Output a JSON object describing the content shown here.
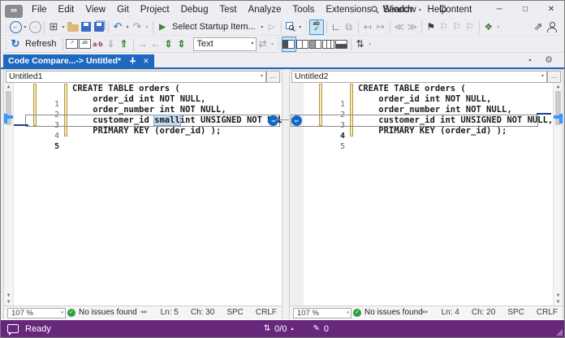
{
  "titlebar": {
    "menus": [
      "File",
      "Edit",
      "View",
      "Git",
      "Project",
      "Debug",
      "Test",
      "Analyze",
      "Tools",
      "Extensions",
      "Window",
      "Help"
    ],
    "search_label": "Search",
    "content_label": "Content"
  },
  "toolbar": {
    "startup_item": "Select Startup Item...",
    "refresh_label": "Refresh",
    "compare_mode_value": "Text",
    "row1_icons": [
      "navigate-back",
      "navigate-forward",
      "new-project",
      "open-file",
      "save",
      "save-all",
      "undo",
      "redo",
      "start-debugging",
      "start-without-debugging",
      "find-in-files",
      "spell-check",
      "ruler",
      "copy-format",
      "navigate-prev",
      "navigate-next",
      "shift-left",
      "shift-right",
      "toggle-bookmark",
      "prev-bookmark",
      "next-bookmark",
      "clear-bookmarks",
      "code-cleanup",
      "send-feedback",
      "account"
    ],
    "row2_icons": [
      "refresh",
      "fit-view",
      "find-text",
      "ignore-case",
      "next-difference",
      "prev-difference",
      "copy-to-right",
      "copy-to-left",
      "expand-all",
      "collapse-all",
      "sync-scrolling",
      "layout-side-by-side",
      "layout-vertical-split",
      "layout-left-emphasis",
      "layout-three-way",
      "layout-horizontal",
      "merge-lines"
    ]
  },
  "tabbar": {
    "active_tab": "Code Compare...-> Untitled*"
  },
  "panes": [
    {
      "file": "Untitled1",
      "zoom": "107 %",
      "issues": "No issues found",
      "ln": "Ln: 5",
      "ch": "Ch: 30",
      "spc": "SPC",
      "eol": "CRLF",
      "lines": [
        {
          "num": "1",
          "text": "CREATE TABLE orders ("
        },
        {
          "num": "2",
          "text": "    order_id int NOT NULL,"
        },
        {
          "num": "3",
          "text": "    order_number int NOT NULL,"
        },
        {
          "num": "4",
          "pre": "    customer_id ",
          "sel": "small",
          "post": "int UNSIGNED NOT NULL,"
        },
        {
          "num": "5",
          "text": "    PRIMARY KEY (order_id) );"
        }
      ]
    },
    {
      "file": "Untitled2",
      "zoom": "107 %",
      "issues": "No issues found",
      "ln": "Ln: 4",
      "ch": "Ch: 20",
      "spc": "SPC",
      "eol": "CRLF",
      "lines": [
        {
          "num": "1",
          "text": "CREATE TABLE orders ("
        },
        {
          "num": "2",
          "text": "    order_id int NOT NULL,"
        },
        {
          "num": "3",
          "text": "    order_number int NOT NULL,"
        },
        {
          "num": "4",
          "text": "    customer_id int UNSIGNED NOT NULL,"
        },
        {
          "num": "5",
          "text": "    PRIMARY KEY (order_id) );"
        }
      ]
    }
  ],
  "statusbar": {
    "ready": "Ready",
    "diff_count": "0/0",
    "edit_count": "0"
  },
  "colors": {
    "accent_blue": "#1e68c0",
    "status_purple": "#67287c",
    "diff_marker_blue": "#3399ff",
    "change_bar_gold": "#b8962e",
    "check_green": "#2da042",
    "merge_button_blue": "#1468c8"
  }
}
